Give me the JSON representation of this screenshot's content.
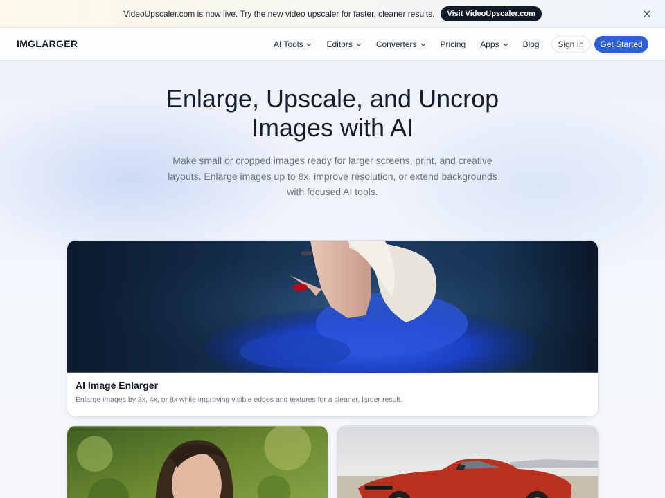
{
  "announcement": {
    "text": "VideoUpscaler.com is now live. Try the new video upscaler for faster, cleaner results.",
    "button_label": "Visit VideoUpscaler.com",
    "close_icon": "close-icon"
  },
  "header": {
    "logo": "IMGLARGER",
    "nav": [
      {
        "label": "AI Tools",
        "dropdown": true
      },
      {
        "label": "Editors",
        "dropdown": true
      },
      {
        "label": "Converters",
        "dropdown": true
      },
      {
        "label": "Pricing",
        "dropdown": false
      },
      {
        "label": "Apps",
        "dropdown": true
      },
      {
        "label": "Blog",
        "dropdown": false
      }
    ],
    "sign_in": "Sign In",
    "get_started": "Get Started"
  },
  "hero": {
    "title_line1": "Enlarge, Upscale, and Uncrop",
    "title_line2": "Images with AI",
    "subtitle": "Make small or cropped images ready for larger screens, print, and creative layouts. Enlarge images up to 8x, improve resolution, or extend backgrounds with focused AI tools."
  },
  "cards": [
    {
      "title": "AI Image Enlarger",
      "description": "Enlarge images by 2x, 4x, or 8x while improving visible edges and textures for a cleaner, larger result."
    }
  ],
  "colors": {
    "accent": "#2f5fd8",
    "dark_button": "#111827",
    "muted_text": "#6b7280"
  }
}
